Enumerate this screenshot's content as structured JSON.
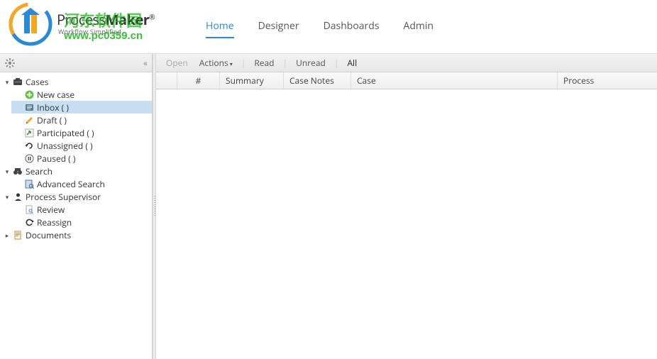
{
  "logo": {
    "brand_a": "Process",
    "brand_b": "Maker",
    "reg": "®",
    "tagline": "Workflow Simplified"
  },
  "watermark": {
    "line1": "河东软件园",
    "line2": "www.pc0359.cn"
  },
  "topnav": {
    "home": "Home",
    "designer": "Designer",
    "dashboards": "Dashboards",
    "admin": "Admin"
  },
  "tree": {
    "cases": "Cases",
    "new_case": "New case",
    "inbox": "Inbox ( )",
    "draft": "Draft ( )",
    "participated": "Participated ( )",
    "unassigned": "Unassigned ( )",
    "paused": "Paused ( )",
    "search": "Search",
    "advanced_search": "Advanced Search",
    "supervisor": "Process Supervisor",
    "review": "Review",
    "reassign": "Reassign",
    "documents": "Documents"
  },
  "toolbar": {
    "open": "Open",
    "actions": "Actions",
    "read": "Read",
    "unread": "Unread",
    "all": "All"
  },
  "columns": {
    "hash": "#",
    "summary": "Summary",
    "notes": "Case Notes",
    "case": "Case",
    "process": "Process"
  }
}
